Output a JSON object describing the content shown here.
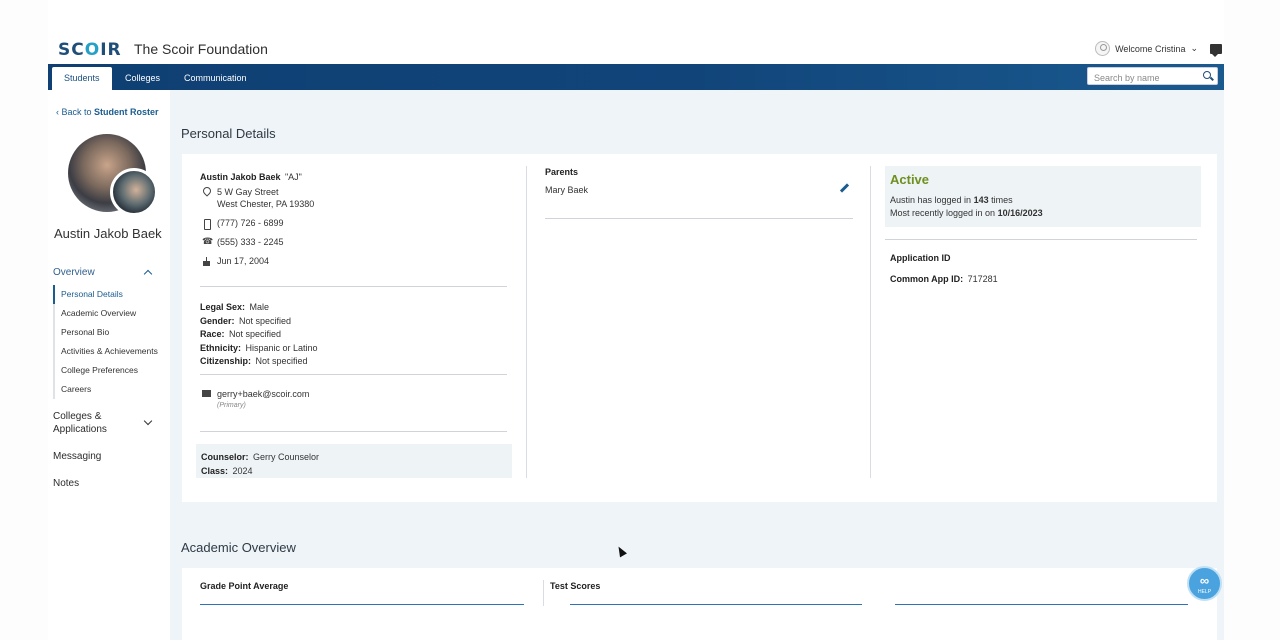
{
  "app": {
    "logo_text_1": "SC",
    "logo_text_2": "O",
    "logo_text_3": "IR",
    "organization": "The Scoir Foundation",
    "welcome": "Welcome Cristina",
    "welcome_caret": "⌄"
  },
  "nav": {
    "tabs": [
      {
        "label": "Students",
        "active": true
      },
      {
        "label": "Colleges",
        "active": false
      },
      {
        "label": "Communication",
        "active": false
      }
    ],
    "search_placeholder": "Search by name"
  },
  "sidebar": {
    "back_prefix": "‹ Back to ",
    "back_target": "Student Roster",
    "student_name": "Austin Jakob Baek",
    "overview_label": "Overview",
    "overview_items": [
      {
        "label": "Personal Details",
        "active": true
      },
      {
        "label": "Academic Overview",
        "active": false
      },
      {
        "label": "Personal Bio",
        "active": false
      },
      {
        "label": "Activities & Achievements",
        "active": false
      },
      {
        "label": "College Preferences",
        "active": false
      },
      {
        "label": "Careers",
        "active": false
      }
    ],
    "colleges_label_1": "Colleges &",
    "colleges_label_2": "Applications",
    "messaging_label": "Messaging",
    "notes_label": "Notes"
  },
  "personal_details": {
    "title": "Personal Details",
    "full_name": "Austin Jakob Baek",
    "nickname": "\"AJ\"",
    "address_line1": "5 W Gay Street",
    "address_line2": "West Chester, PA 19380",
    "mobile": "(777) 726 - 6899",
    "phone": "(555) 333 - 2245",
    "birthday": "Jun 17, 2004",
    "demographics": [
      {
        "label": "Legal Sex:",
        "value": "Male"
      },
      {
        "label": "Gender:",
        "value": "Not specified"
      },
      {
        "label": "Race:",
        "value": "Not specified"
      },
      {
        "label": "Ethnicity:",
        "value": "Hispanic or Latino"
      },
      {
        "label": "Citizenship:",
        "value": "Not specified"
      }
    ],
    "email": "gerry+baek@scoir.com",
    "email_type": "(Primary)",
    "counselor_label": "Counselor:",
    "counselor_value": "Gerry Counselor",
    "class_label": "Class:",
    "class_value": "2024",
    "parents_label": "Parents",
    "parent_name": "Mary Baek",
    "status": "Active",
    "login_prefix": "Austin has logged in ",
    "login_count": "143",
    "login_suffix": " times",
    "last_login_prefix": "Most recently logged in on ",
    "last_login_date": "10/16/2023",
    "application_id_label": "Application ID",
    "common_app_label": "Common App ID:",
    "common_app_value": "717281"
  },
  "academic_overview": {
    "title": "Academic Overview",
    "gpa_label": "Grade Point Average",
    "test_scores_label": "Test Scores"
  },
  "help": {
    "glyph": "∞",
    "label": "HELP"
  }
}
